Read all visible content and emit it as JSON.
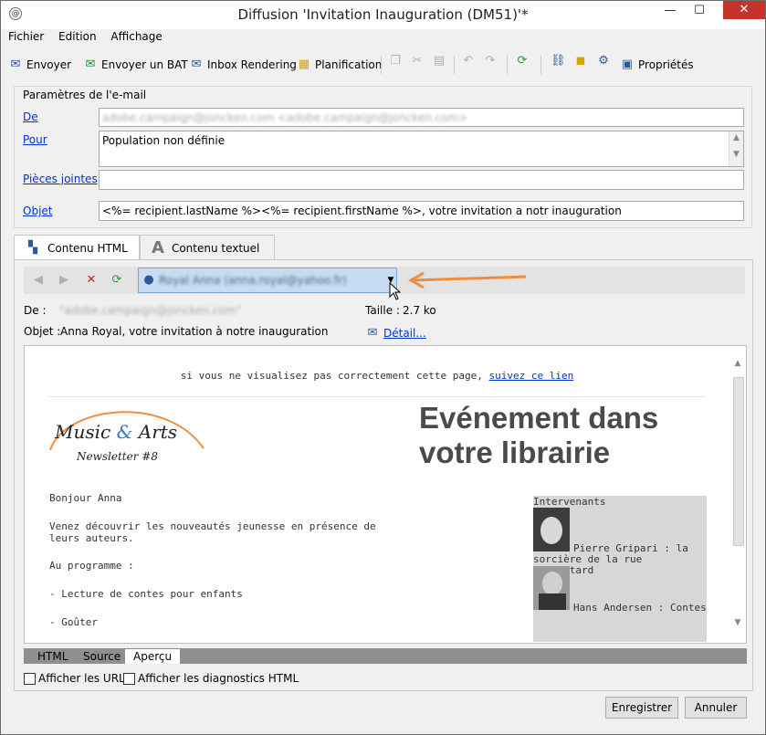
{
  "window": {
    "title": "Diffusion 'Invitation Inauguration (DM51)'*"
  },
  "menu": [
    "Fichier",
    "Edition",
    "Affichage"
  ],
  "toolbar": {
    "send": "Envoyer",
    "send_proof": "Envoyer un BAT",
    "inbox_rendering": "Inbox Rendering",
    "planning": "Planification",
    "properties": "Propriétés"
  },
  "email_params": {
    "title": "Paramètres de l'e-mail",
    "from_label": "De",
    "from_value": "adobe.campaign@joncken.com <adobe.campaign@joncken.com>",
    "to_label": "Pour",
    "to_value": "Population non définie",
    "attachments_label": "Pièces jointes",
    "attachments_value": "",
    "subject_label": "Objet",
    "subject_value": "<%= recipient.lastName %><%= recipient.firstName %>, votre invitation a notr inauguration"
  },
  "tabs": {
    "html": "Contenu HTML",
    "text": "Contenu textuel"
  },
  "nav": {
    "recipient": "Royal Anna (anna.royal@yahoo.fr)"
  },
  "meta": {
    "from_label": "De :",
    "from_value": "\"adobe.campaign@joncken.com\"",
    "size_label": "Taille :",
    "size_value": "2.7 ko",
    "subject_label": "Objet :",
    "subject_value": "Anna Royal, votre invitation à notre inauguration",
    "detail_link": "Détail..."
  },
  "preview": {
    "view_text": "si vous ne visualisez pas correctement cette page,",
    "view_link": "suivez ce lien",
    "logo_main": "Music",
    "logo_amp": "&",
    "logo_arts": "Arts",
    "logo_sub": "Newsletter #8",
    "headline": "Evénement dans votre librairie",
    "greeting": "Bonjour Anna",
    "p1": "Venez découvrir les nouveautés jeunesse en présence de leurs auteurs.",
    "program": "Au programme :",
    "item1": "- Lecture de contes pour enfants",
    "item2": "- Goûter",
    "speakers_title": "Intervenants",
    "speaker1": "Pierre Gripari : la sorcière de la rue Mouffetard",
    "speaker2": "Hans Andersen : Contes"
  },
  "bottom_tabs": [
    "HTML",
    "Source",
    "Aperçu"
  ],
  "checks": {
    "show_url": "Afficher les URL",
    "show_diag": "Afficher les diagnostics HTML"
  },
  "buttons": {
    "save": "Enregistrer",
    "cancel": "Annuler"
  },
  "colors": {
    "accent_orange": "#f08c3c",
    "link_blue": "#0033cc",
    "logo_blue": "#3a78c8"
  }
}
